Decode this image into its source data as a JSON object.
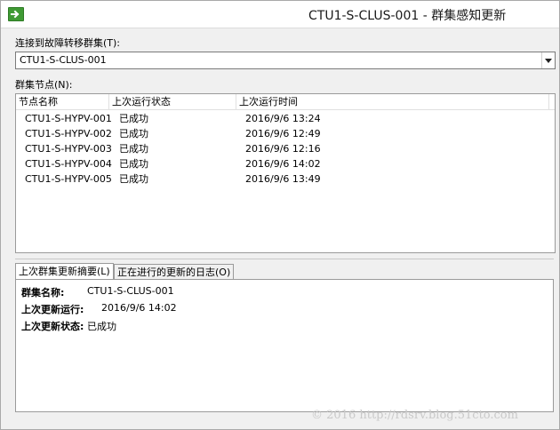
{
  "window": {
    "title": "CTU1-S-CLUS-001 - 群集感知更新",
    "icon": "green-arrow-icon"
  },
  "connect": {
    "label": "连接到故障转移群集(T):",
    "selected": "CTU1-S-CLUS-001"
  },
  "nodes": {
    "label": "群集节点(N):",
    "columns": [
      "节点名称",
      "上次运行状态",
      "上次运行时间"
    ],
    "rows": [
      [
        "CTU1-S-HYPV-001",
        "已成功",
        "2016/9/6 13:24"
      ],
      [
        "CTU1-S-HYPV-002",
        "已成功",
        "2016/9/6 12:49"
      ],
      [
        "CTU1-S-HYPV-003",
        "已成功",
        "2016/9/6 12:16"
      ],
      [
        "CTU1-S-HYPV-004",
        "已成功",
        "2016/9/6 14:02"
      ],
      [
        "CTU1-S-HYPV-005",
        "已成功",
        "2016/9/6 13:49"
      ]
    ]
  },
  "tabs": {
    "summary": "上次群集更新摘要(L)",
    "log": "正在进行的更新的日志(O)"
  },
  "summary": {
    "cluster_name_label": "群集名称:",
    "cluster_name_value": "CTU1-S-CLUS-001",
    "last_run_label": "上次更新运行:",
    "last_run_value": "2016/9/6 14:02",
    "last_status_label": "上次更新状态:",
    "last_status_value": "已成功"
  },
  "watermark": "© 2016 http://rdsrv.blog.51cto.com"
}
